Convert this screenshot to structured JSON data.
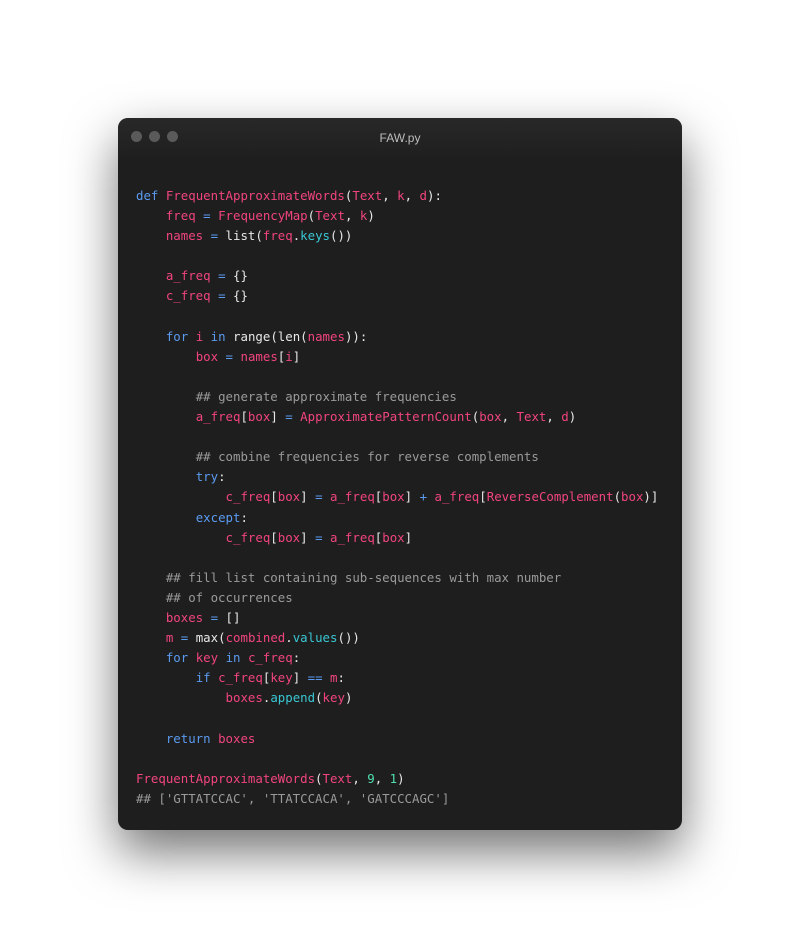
{
  "window": {
    "title": "FAW.py",
    "traffic_lights": [
      "close",
      "minimize",
      "maximize"
    ]
  },
  "colors": {
    "keyword": "#5b9bf0",
    "identifier": "#f1447f",
    "method": "#39c7d3",
    "number": "#4fe0b0",
    "comment": "#9a9a9a",
    "background": "#1e1e1e"
  },
  "code": {
    "language": "python",
    "lines": [
      [
        [
          "kw",
          "def"
        ],
        [
          "pl",
          " "
        ],
        [
          "fn",
          "FrequentApproximateWords"
        ],
        [
          "pl",
          "("
        ],
        [
          "var",
          "Text"
        ],
        [
          "pl",
          ", "
        ],
        [
          "var",
          "k"
        ],
        [
          "pl",
          ", "
        ],
        [
          "var",
          "d"
        ],
        [
          "pl",
          "):"
        ]
      ],
      [
        [
          "pl",
          "    "
        ],
        [
          "var",
          "freq"
        ],
        [
          "pl",
          " "
        ],
        [
          "op",
          "="
        ],
        [
          "pl",
          " "
        ],
        [
          "fn",
          "FrequencyMap"
        ],
        [
          "pl",
          "("
        ],
        [
          "var",
          "Text"
        ],
        [
          "pl",
          ", "
        ],
        [
          "var",
          "k"
        ],
        [
          "pl",
          ")"
        ]
      ],
      [
        [
          "pl",
          "    "
        ],
        [
          "var",
          "names"
        ],
        [
          "pl",
          " "
        ],
        [
          "op",
          "="
        ],
        [
          "pl",
          " list("
        ],
        [
          "var",
          "freq"
        ],
        [
          "pl",
          "."
        ],
        [
          "attr",
          "keys"
        ],
        [
          "pl",
          "())"
        ]
      ],
      [],
      [
        [
          "pl",
          "    "
        ],
        [
          "var",
          "a_freq"
        ],
        [
          "pl",
          " "
        ],
        [
          "op",
          "="
        ],
        [
          "pl",
          " {}"
        ]
      ],
      [
        [
          "pl",
          "    "
        ],
        [
          "var",
          "c_freq"
        ],
        [
          "pl",
          " "
        ],
        [
          "op",
          "="
        ],
        [
          "pl",
          " {}"
        ]
      ],
      [],
      [
        [
          "pl",
          "    "
        ],
        [
          "kw",
          "for"
        ],
        [
          "pl",
          " "
        ],
        [
          "var",
          "i"
        ],
        [
          "pl",
          " "
        ],
        [
          "kw",
          "in"
        ],
        [
          "pl",
          " range(len("
        ],
        [
          "var",
          "names"
        ],
        [
          "pl",
          ")):"
        ]
      ],
      [
        [
          "pl",
          "        "
        ],
        [
          "var",
          "box"
        ],
        [
          "pl",
          " "
        ],
        [
          "op",
          "="
        ],
        [
          "pl",
          " "
        ],
        [
          "var",
          "names"
        ],
        [
          "pl",
          "["
        ],
        [
          "var",
          "i"
        ],
        [
          "pl",
          "]"
        ]
      ],
      [],
      [
        [
          "pl",
          "        "
        ],
        [
          "com",
          "## generate approximate frequencies"
        ]
      ],
      [
        [
          "pl",
          "        "
        ],
        [
          "var",
          "a_freq"
        ],
        [
          "pl",
          "["
        ],
        [
          "var",
          "box"
        ],
        [
          "pl",
          "] "
        ],
        [
          "op",
          "="
        ],
        [
          "pl",
          " "
        ],
        [
          "fn",
          "ApproximatePatternCount"
        ],
        [
          "pl",
          "("
        ],
        [
          "var",
          "box"
        ],
        [
          "pl",
          ", "
        ],
        [
          "var",
          "Text"
        ],
        [
          "pl",
          ", "
        ],
        [
          "var",
          "d"
        ],
        [
          "pl",
          ")"
        ]
      ],
      [],
      [
        [
          "pl",
          "        "
        ],
        [
          "com",
          "## combine frequencies for reverse complements"
        ]
      ],
      [
        [
          "pl",
          "        "
        ],
        [
          "kw",
          "try"
        ],
        [
          "pl",
          ":"
        ]
      ],
      [
        [
          "pl",
          "            "
        ],
        [
          "var",
          "c_freq"
        ],
        [
          "pl",
          "["
        ],
        [
          "var",
          "box"
        ],
        [
          "pl",
          "] "
        ],
        [
          "op",
          "="
        ],
        [
          "pl",
          " "
        ],
        [
          "var",
          "a_freq"
        ],
        [
          "pl",
          "["
        ],
        [
          "var",
          "box"
        ],
        [
          "pl",
          "] "
        ],
        [
          "op",
          "+"
        ],
        [
          "pl",
          " "
        ],
        [
          "var",
          "a_freq"
        ],
        [
          "pl",
          "["
        ],
        [
          "fn",
          "ReverseComplement"
        ],
        [
          "pl",
          "("
        ],
        [
          "var",
          "box"
        ],
        [
          "pl",
          ")]"
        ]
      ],
      [
        [
          "pl",
          "        "
        ],
        [
          "kw",
          "except"
        ],
        [
          "pl",
          ":"
        ]
      ],
      [
        [
          "pl",
          "            "
        ],
        [
          "var",
          "c_freq"
        ],
        [
          "pl",
          "["
        ],
        [
          "var",
          "box"
        ],
        [
          "pl",
          "] "
        ],
        [
          "op",
          "="
        ],
        [
          "pl",
          " "
        ],
        [
          "var",
          "a_freq"
        ],
        [
          "pl",
          "["
        ],
        [
          "var",
          "box"
        ],
        [
          "pl",
          "]"
        ]
      ],
      [],
      [
        [
          "pl",
          "    "
        ],
        [
          "com",
          "## fill list containing sub-sequences with max number"
        ]
      ],
      [
        [
          "pl",
          "    "
        ],
        [
          "com",
          "## of occurrences"
        ]
      ],
      [
        [
          "pl",
          "    "
        ],
        [
          "var",
          "boxes"
        ],
        [
          "pl",
          " "
        ],
        [
          "op",
          "="
        ],
        [
          "pl",
          " []"
        ]
      ],
      [
        [
          "pl",
          "    "
        ],
        [
          "var",
          "m"
        ],
        [
          "pl",
          " "
        ],
        [
          "op",
          "="
        ],
        [
          "pl",
          " max("
        ],
        [
          "var",
          "combined"
        ],
        [
          "pl",
          "."
        ],
        [
          "attr",
          "values"
        ],
        [
          "pl",
          "())"
        ]
      ],
      [
        [
          "pl",
          "    "
        ],
        [
          "kw",
          "for"
        ],
        [
          "pl",
          " "
        ],
        [
          "var",
          "key"
        ],
        [
          "pl",
          " "
        ],
        [
          "kw",
          "in"
        ],
        [
          "pl",
          " "
        ],
        [
          "var",
          "c_freq"
        ],
        [
          "pl",
          ":"
        ]
      ],
      [
        [
          "pl",
          "        "
        ],
        [
          "kw",
          "if"
        ],
        [
          "pl",
          " "
        ],
        [
          "var",
          "c_freq"
        ],
        [
          "pl",
          "["
        ],
        [
          "var",
          "key"
        ],
        [
          "pl",
          "] "
        ],
        [
          "op",
          "=="
        ],
        [
          "pl",
          " "
        ],
        [
          "var",
          "m"
        ],
        [
          "pl",
          ":"
        ]
      ],
      [
        [
          "pl",
          "            "
        ],
        [
          "var",
          "boxes"
        ],
        [
          "pl",
          "."
        ],
        [
          "attr",
          "append"
        ],
        [
          "pl",
          "("
        ],
        [
          "var",
          "key"
        ],
        [
          "pl",
          ")"
        ]
      ],
      [],
      [
        [
          "pl",
          "    "
        ],
        [
          "kw",
          "return"
        ],
        [
          "pl",
          " "
        ],
        [
          "var",
          "boxes"
        ]
      ],
      [],
      [
        [
          "fn",
          "FrequentApproximateWords"
        ],
        [
          "pl",
          "("
        ],
        [
          "var",
          "Text"
        ],
        [
          "pl",
          ", "
        ],
        [
          "num",
          "9"
        ],
        [
          "pl",
          ", "
        ],
        [
          "num",
          "1"
        ],
        [
          "pl",
          ")"
        ]
      ],
      [
        [
          "com",
          "## ['GTTATCCAC', 'TTATCCACA', 'GATCCCAGC']"
        ]
      ]
    ]
  }
}
